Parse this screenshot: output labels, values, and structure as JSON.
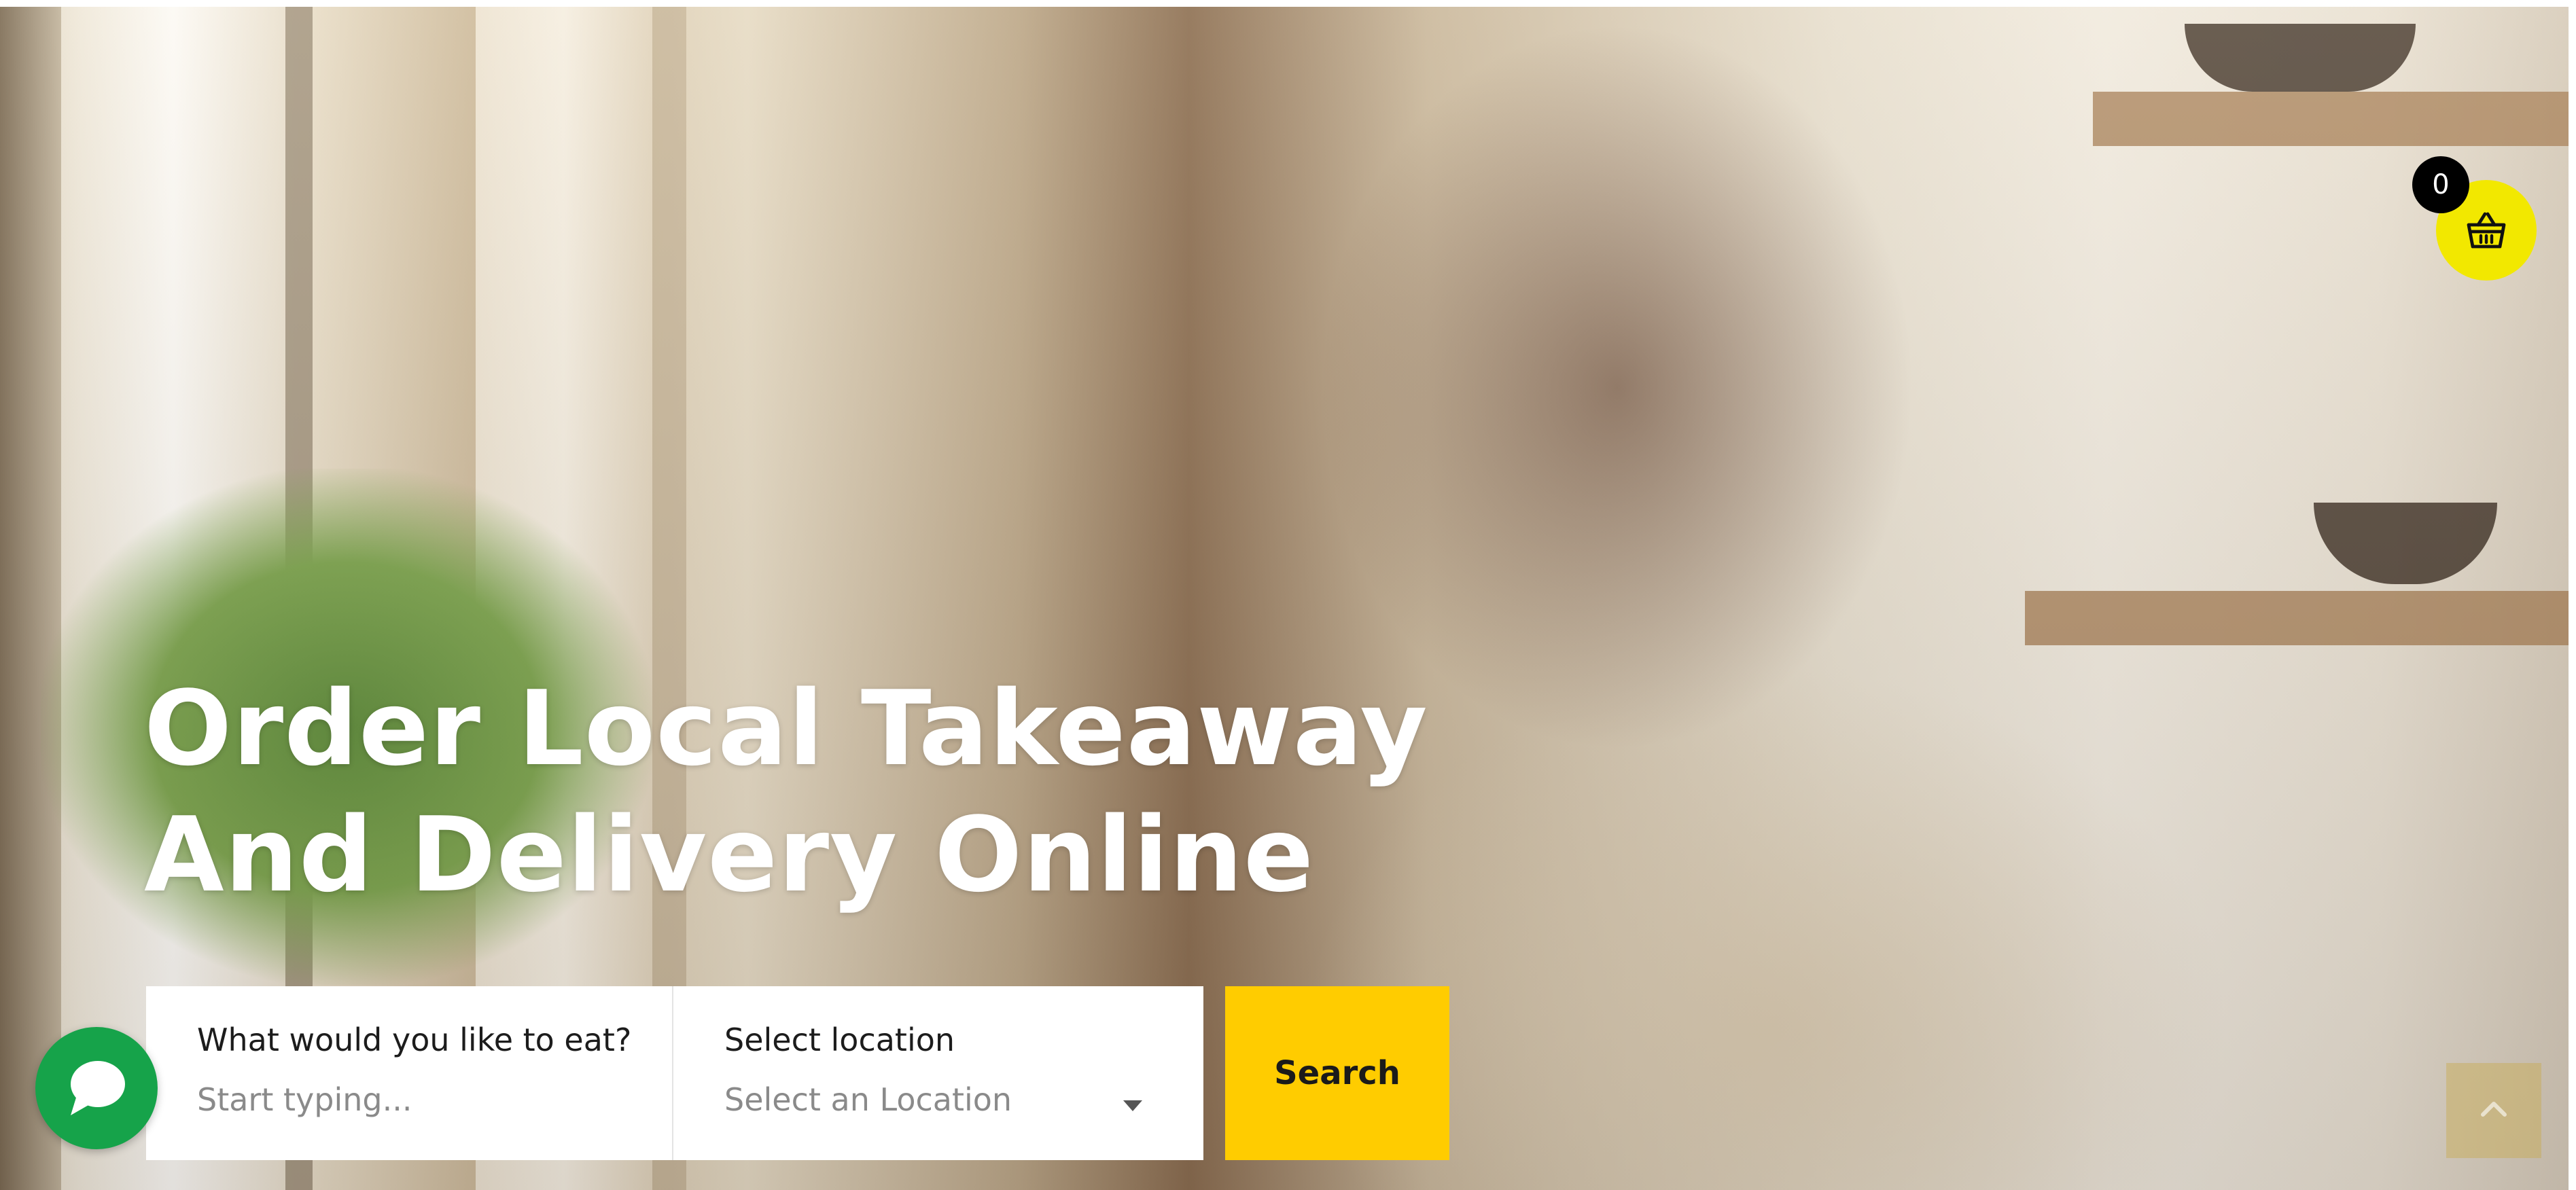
{
  "hero": {
    "headline_line1": "Order Local Takeaway",
    "headline_line2": "And Delivery Online"
  },
  "search": {
    "food_label": "What would you like to eat?",
    "food_placeholder": "Start typing...",
    "location_label": "Select location",
    "location_selected": "Select an Location",
    "button_label": "Search"
  },
  "cart": {
    "count": "0",
    "icon": "basket-icon"
  },
  "chat": {
    "icon": "chat-bubble-icon"
  },
  "scroll_top": {
    "icon": "arrow-up-icon"
  },
  "colors": {
    "accent": "#ffcc00",
    "cart": "#f2e800",
    "chat": "#16a34a"
  }
}
